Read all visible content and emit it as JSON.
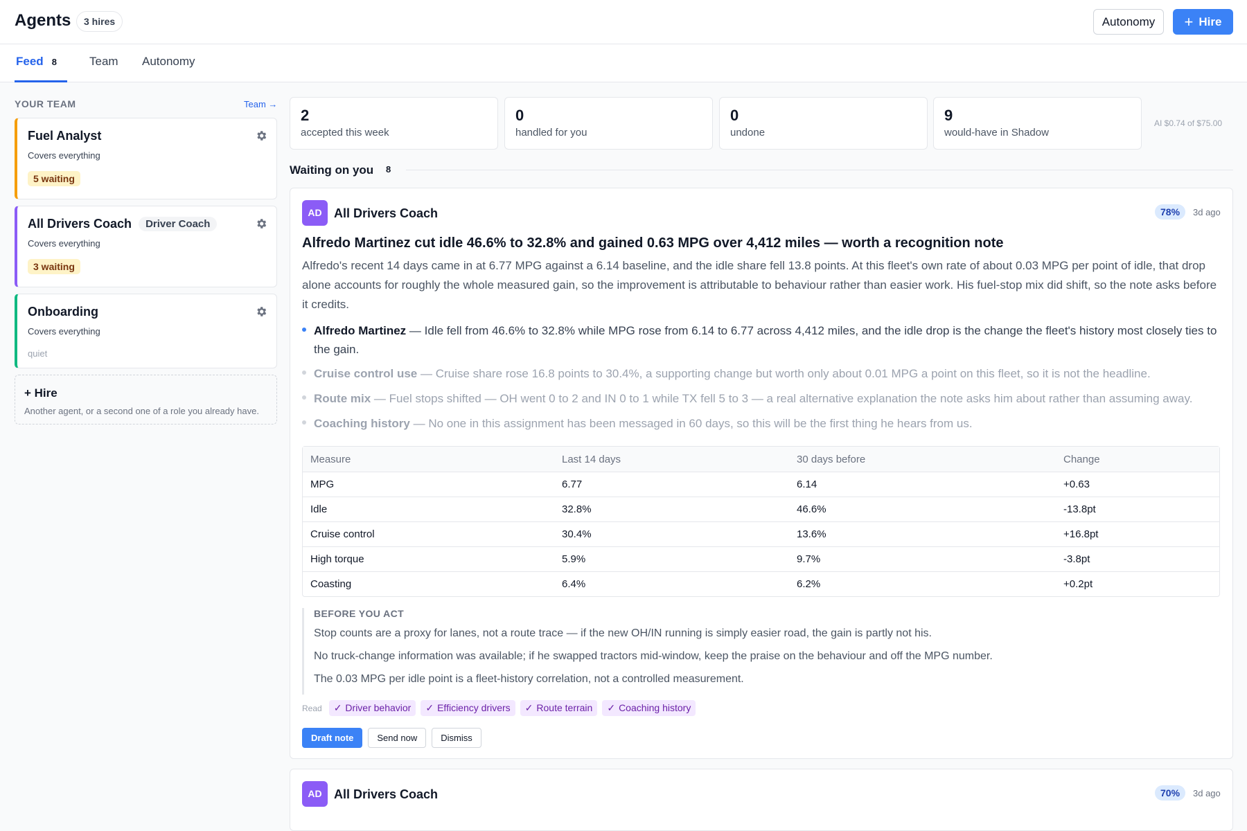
{
  "header": {
    "title": "Agents",
    "hires_badge": "3 hires",
    "autonomy_button": "Autonomy",
    "hire_button": "Hire"
  },
  "tabs": [
    {
      "label": "Feed",
      "count": "8",
      "active": true
    },
    {
      "label": "Team"
    },
    {
      "label": "Autonomy"
    }
  ],
  "sidebar": {
    "heading": "YOUR TEAM",
    "team_link": "Team →",
    "agents": [
      {
        "name": "Fuel Analyst",
        "role": "",
        "coverage": "Covers everything",
        "status": "5 waiting",
        "accent": "#f59e0b"
      },
      {
        "name": "All Drivers Coach",
        "role": "Driver Coach",
        "coverage": "Covers everything",
        "status": "3 waiting",
        "accent": "#8b5cf6"
      },
      {
        "name": "Onboarding",
        "role": "",
        "coverage": "Covers everything",
        "status": "quiet",
        "accent": "#10b981"
      }
    ],
    "hire_card": {
      "title": "+ Hire",
      "subtitle": "Another agent, or a second one of a role you already have."
    }
  },
  "stats": [
    {
      "value": "2",
      "label": "accepted this week"
    },
    {
      "value": "0",
      "label": "handled for you"
    },
    {
      "value": "0",
      "label": "undone"
    },
    {
      "value": "9",
      "label": "would-have in Shadow"
    }
  ],
  "budget": "AI $0.74 of $75.00",
  "waiting": {
    "label": "Waiting on you",
    "count": "8"
  },
  "feed": [
    {
      "avatar": "AD",
      "agent": "All Drivers Coach",
      "confidence": "78%",
      "age": "3d ago",
      "headline": "Alfredo Martinez cut idle 46.6% to 32.8% and gained 0.63 MPG over 4,412 miles — worth a recognition note",
      "summary": "Alfredo's recent 14 days came in at 6.77 MPG against a 6.14 baseline, and the idle share fell 13.8 points. At this fleet's own rate of about 0.03 MPG per point of idle, that drop alone accounts for roughly the whole measured gain, so the improvement is attributable to behaviour rather than easier work. His fuel-stop mix did shift, so the note asks before it credits.",
      "points": [
        {
          "name": "Alfredo Martinez",
          "text": "— Idle fell from 46.6% to 32.8% while MPG rose from 6.14 to 6.77 across 4,412 miles, and the idle drop is the change the fleet's history most closely ties to the gain."
        },
        {
          "name": "Cruise control use",
          "text": "— Cruise share rose 16.8 points to 30.4%, a supporting change but worth only about 0.01 MPG a point on this fleet, so it is not the headline."
        },
        {
          "name": "Route mix",
          "text": "— Fuel stops shifted — OH went 0 to 2 and IN 0 to 1 while TX fell 5 to 3 — a real alternative explanation the note asks him about rather than assuming away."
        },
        {
          "name": "Coaching history",
          "text": "— No one in this assignment has been messaged in 60 days, so this will be the first thing he hears from us."
        }
      ],
      "table": {
        "columns": [
          "Measure",
          "Last 14 days",
          "30 days before",
          "Change"
        ],
        "rows": [
          [
            "MPG",
            "6.77",
            "6.14",
            "+0.63"
          ],
          [
            "Idle",
            "32.8%",
            "46.6%",
            "-13.8pt"
          ],
          [
            "Cruise control",
            "30.4%",
            "13.6%",
            "+16.8pt"
          ],
          [
            "High torque",
            "5.9%",
            "9.7%",
            "-3.8pt"
          ],
          [
            "Coasting",
            "6.4%",
            "6.2%",
            "+0.2pt"
          ]
        ]
      },
      "before_you_act": {
        "heading": "BEFORE YOU ACT",
        "items": [
          "Stop counts are a proxy for lanes, not a route trace — if the new OH/IN running is simply easier road, the gain is partly not his.",
          "No truck-change information was available; if he swapped tractors mid-window, keep the praise on the behaviour and off the MPG number.",
          "The 0.03 MPG per idle point is a fleet-history correlation, not a controlled measurement."
        ]
      },
      "read_label": "Read",
      "read_tags": [
        "Driver behavior",
        "Efficiency drivers",
        "Route terrain",
        "Coaching history"
      ],
      "actions": {
        "primary": "Draft note",
        "secondary": "Send now",
        "dismiss": "Dismiss"
      }
    },
    {
      "avatar": "AD",
      "agent": "All Drivers Coach",
      "confidence": "70%",
      "age": "3d ago"
    }
  ]
}
